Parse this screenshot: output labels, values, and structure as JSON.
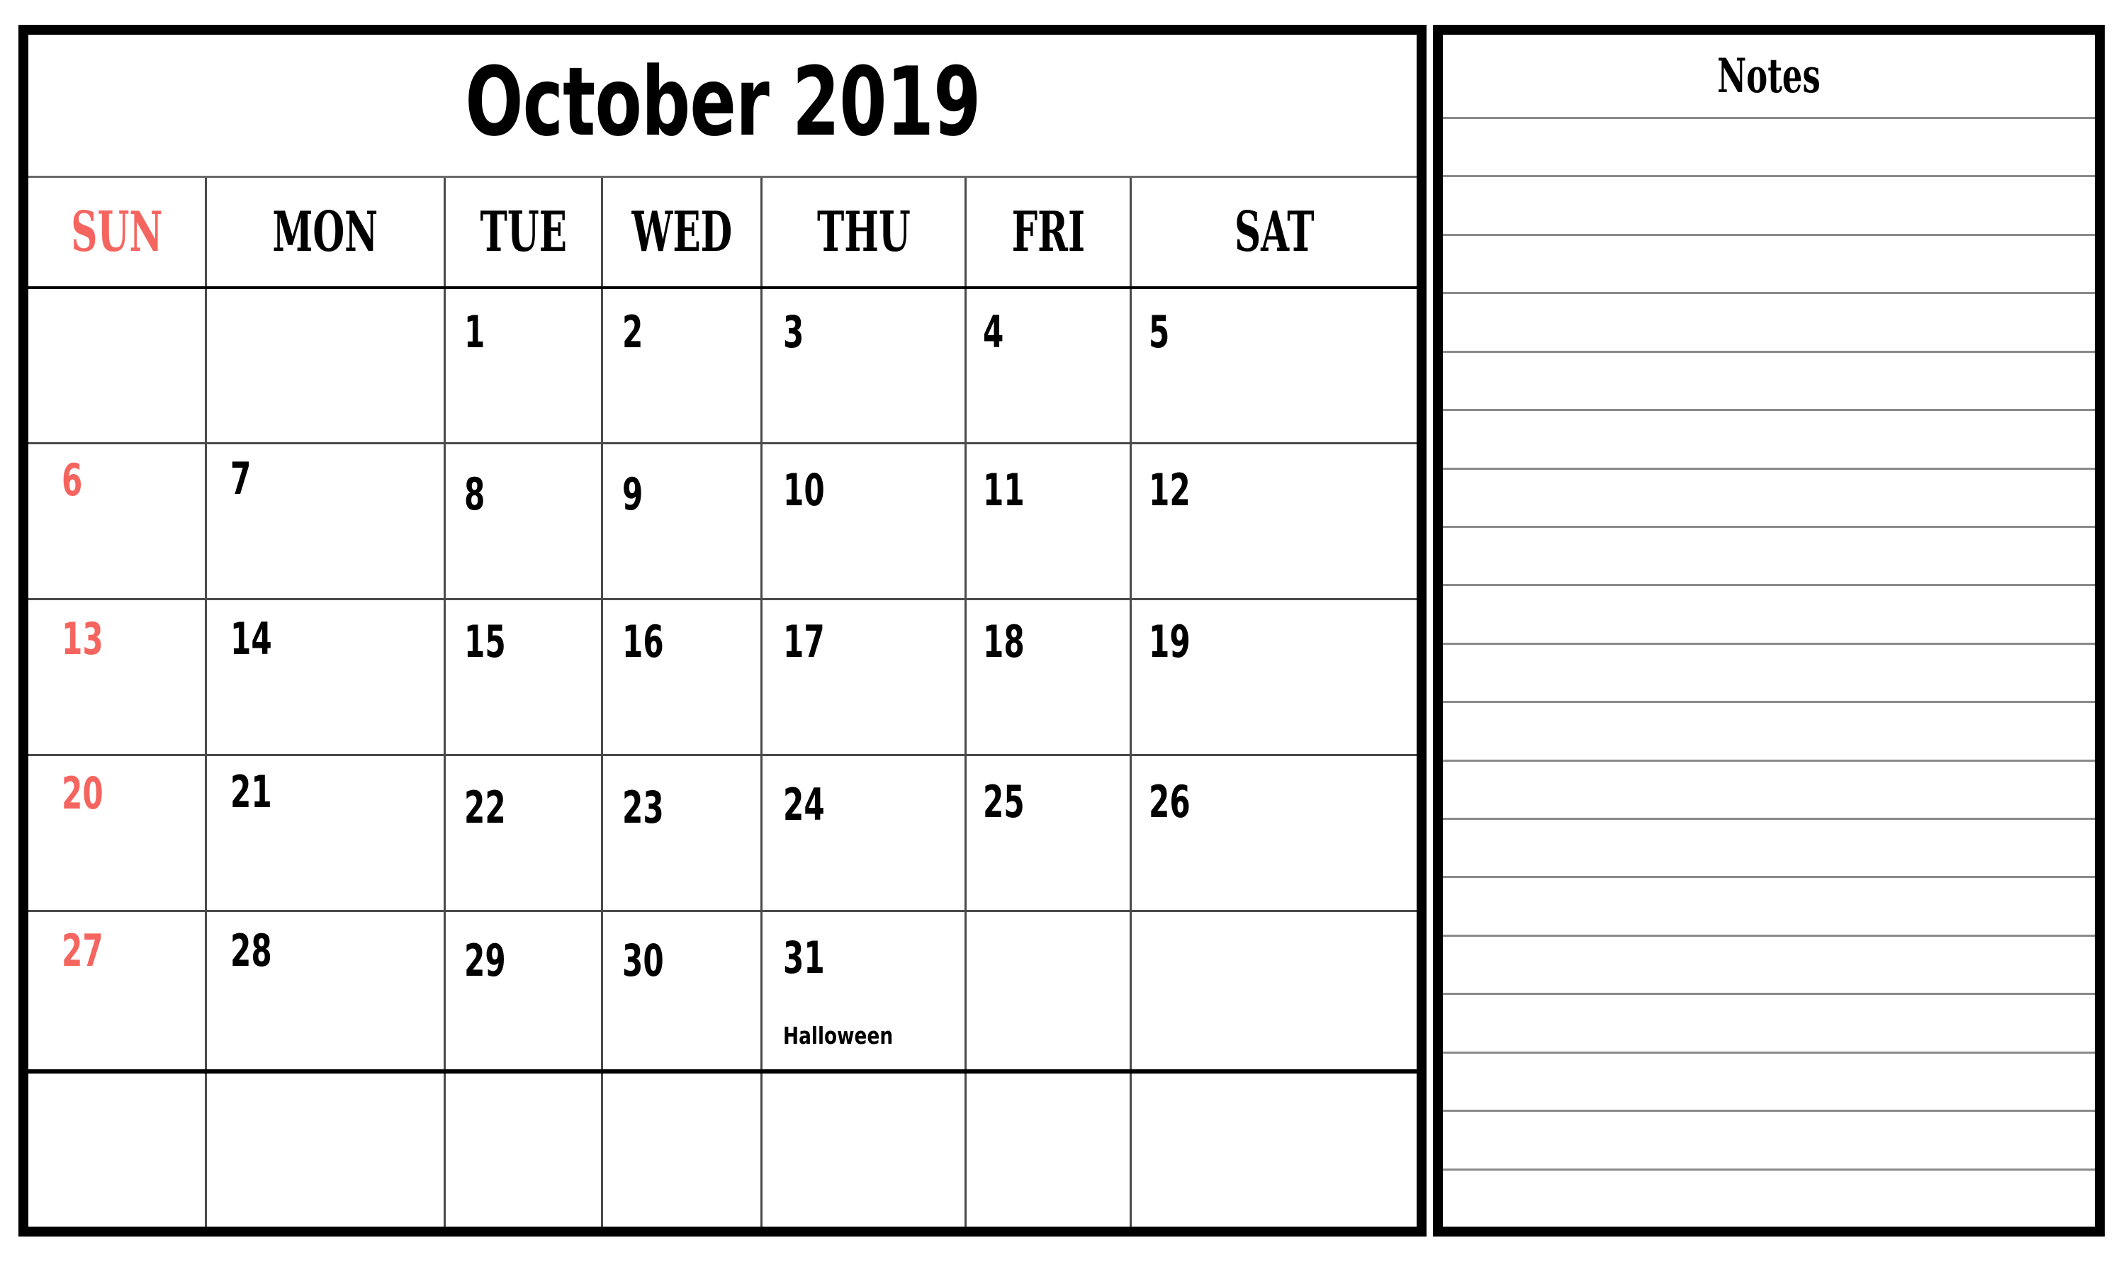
{
  "calendar": {
    "title": "October 2019",
    "month": "October",
    "year": "2019",
    "accent_color": "#F5655F",
    "text_color": "#000000",
    "grid_line_color": "#4a4a4a",
    "weekdays": [
      {
        "label": "SUN",
        "color": "#F5655F"
      },
      {
        "label": "MON",
        "color": "#000000"
      },
      {
        "label": "TUE",
        "color": "#000000"
      },
      {
        "label": "WED",
        "color": "#000000"
      },
      {
        "label": "THU",
        "color": "#000000"
      },
      {
        "label": "FRI",
        "color": "#000000"
      },
      {
        "label": "SAT",
        "color": "#000000"
      }
    ],
    "weeks": [
      [
        {
          "day": ""
        },
        {
          "day": ""
        },
        {
          "day": "1"
        },
        {
          "day": "2"
        },
        {
          "day": "3"
        },
        {
          "day": "4"
        },
        {
          "day": "5"
        }
      ],
      [
        {
          "day": "6"
        },
        {
          "day": "7"
        },
        {
          "day": "8"
        },
        {
          "day": "9"
        },
        {
          "day": "10"
        },
        {
          "day": "11"
        },
        {
          "day": "12"
        }
      ],
      [
        {
          "day": "13"
        },
        {
          "day": "14"
        },
        {
          "day": "15"
        },
        {
          "day": "16"
        },
        {
          "day": "17"
        },
        {
          "day": "18"
        },
        {
          "day": "19"
        }
      ],
      [
        {
          "day": "20"
        },
        {
          "day": "21"
        },
        {
          "day": "22"
        },
        {
          "day": "23"
        },
        {
          "day": "24"
        },
        {
          "day": "25"
        },
        {
          "day": "26"
        }
      ],
      [
        {
          "day": "27"
        },
        {
          "day": "28"
        },
        {
          "day": "29"
        },
        {
          "day": "30"
        },
        {
          "day": "31",
          "event": "Halloween"
        },
        {
          "day": ""
        },
        {
          "day": ""
        }
      ],
      [
        {
          "day": ""
        },
        {
          "day": ""
        },
        {
          "day": ""
        },
        {
          "day": ""
        },
        {
          "day": ""
        },
        {
          "day": ""
        },
        {
          "day": ""
        }
      ]
    ]
  },
  "notes": {
    "title": "Notes",
    "line_count": 19,
    "lines": [
      "",
      "",
      "",
      "",
      "",
      "",
      "",
      "",
      "",
      "",
      "",
      "",
      "",
      "",
      "",
      "",
      "",
      "",
      ""
    ]
  }
}
